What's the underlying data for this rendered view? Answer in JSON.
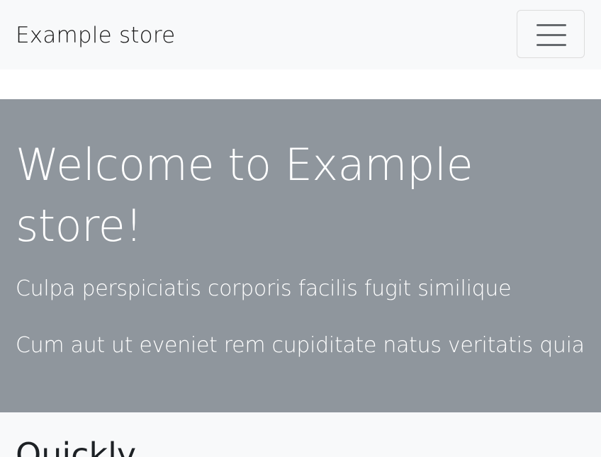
{
  "navbar": {
    "brand": "Example store",
    "toggler_icon": "hamburger-menu-icon"
  },
  "hero": {
    "title": "Welcome to Example store!",
    "lines": [
      "Culpa perspiciatis corporis facilis fugit similique",
      "Cum aut ut eveniet rem cupiditate natus veritatis quia"
    ]
  },
  "section": {
    "title": "Quickly"
  },
  "colors": {
    "navbar_bg": "#f8f9fa",
    "hero_bg": "#8f969d",
    "hero_text": "#ffffff",
    "section_bg": "#f8f9fa"
  }
}
